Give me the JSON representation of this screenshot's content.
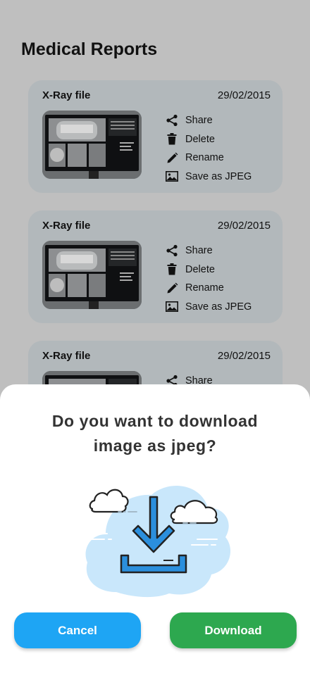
{
  "page": {
    "title": "Medical Reports"
  },
  "reports": [
    {
      "title": "X-Ray file",
      "date": "29/02/2015"
    },
    {
      "title": "X-Ray file",
      "date": "29/02/2015"
    },
    {
      "title": "X-Ray file",
      "date": "29/02/2015"
    }
  ],
  "actions": {
    "share": "Share",
    "delete": "Delete",
    "rename": "Rename",
    "save_jpeg": "Save as JPEG"
  },
  "dialog": {
    "question_line1": "Do you want to download",
    "question_line2": "image as jpeg?",
    "cancel_label": "Cancel",
    "download_label": "Download"
  },
  "icons": {
    "share": "share-icon",
    "delete": "trash-icon",
    "rename": "pencil-icon",
    "save_jpeg": "image-icon",
    "illustration": "cloud-download-icon"
  },
  "colors": {
    "cancel": "#1ea5f4",
    "download": "#2da84f",
    "card": "#b2b8bb",
    "overlay": "#bfbfbf"
  }
}
